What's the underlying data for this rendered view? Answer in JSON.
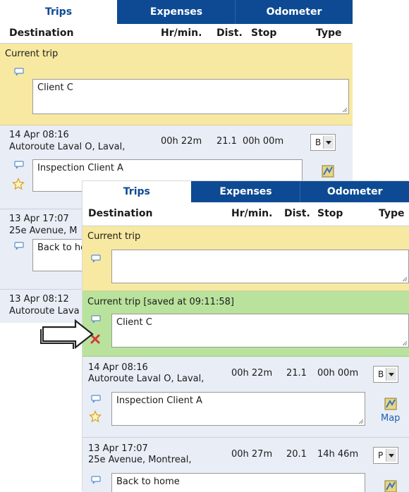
{
  "tabs": [
    "Trips",
    "Expenses",
    "Odometer"
  ],
  "columns": {
    "destination": "Destination",
    "time": "Hr/min.",
    "dist": "Dist.",
    "stop": "Stop",
    "type": "Type"
  },
  "back_panel": {
    "current_trip": {
      "label": "Current trip",
      "note": "Client C"
    },
    "trips": [
      {
        "datetime": "14 Apr 08:16",
        "address": "Autoroute Laval O, Laval,",
        "time": "00h 22m",
        "dist": "21.1",
        "stop": "00h 00m",
        "type": "B",
        "note": "Inspection Client A"
      },
      {
        "datetime": "13 Apr 17:07",
        "address": "25e Avenue, M",
        "note": "Back to ho"
      },
      {
        "datetime": "13 Apr 08:12",
        "address": "Autoroute Lava"
      }
    ]
  },
  "front_panel": {
    "current_trip": {
      "label": "Current trip",
      "note": ""
    },
    "saved_trip": {
      "label": "Current trip [saved at 09:11:58]",
      "note": "Client C"
    },
    "trips": [
      {
        "datetime": "14 Apr 08:16",
        "address": "Autoroute Laval O, Laval,",
        "time": "00h 22m",
        "dist": "21.1",
        "stop": "00h 00m",
        "type": "B",
        "note": "Inspection Client A",
        "map": "Map"
      },
      {
        "datetime": "13 Apr 17:07",
        "address": "25e Avenue, Montreal,",
        "time": "00h 27m",
        "dist": "20.1",
        "stop": "14h 46m",
        "type": "P",
        "note": "Back to home"
      }
    ]
  },
  "colors": {
    "tab_bar": "#0d4a93",
    "current_trip": "#f8e9a2",
    "saved_trip": "#b9e39c",
    "trip_row": "#e9edf5",
    "link": "#1f5fb3"
  },
  "icons": [
    "comment-bubble-icon",
    "star-icon",
    "map-icon",
    "delete-x-icon",
    "arrow-right-icon",
    "dropdown-arrow-icon"
  ]
}
